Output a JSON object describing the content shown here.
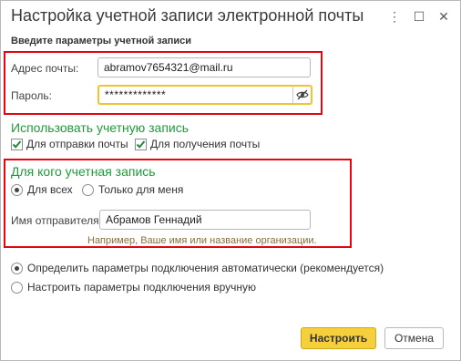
{
  "window": {
    "title": "Настройка учетной записи электронной почты",
    "menu_glyph": "⋮",
    "maximize_glyph": "☐",
    "close_glyph": "✕"
  },
  "subtitle": "Введите параметры учетной записи",
  "account": {
    "email_label": "Адрес почты:",
    "email_value": "abramov7654321@mail.ru",
    "password_label": "Пароль:",
    "password_value": "*************",
    "password_toggle_icon": "eye-slash-icon"
  },
  "usage": {
    "title": "Использовать учетную запись",
    "send_label": "Для отправки почты",
    "send_checked": true,
    "receive_label": "Для получения почты",
    "receive_checked": true
  },
  "audience": {
    "title": "Для кого учетная запись",
    "all_label": "Для всех",
    "all_selected": true,
    "me_label": "Только для меня",
    "me_selected": false,
    "sender_label": "Имя отправителя:",
    "sender_value": "Абрамов Геннадий",
    "sender_hint": "Например, Ваше имя или название организации."
  },
  "connection": {
    "auto_label": "Определить параметры подключения автоматически (рекомендуется)",
    "auto_selected": true,
    "manual_label": "Настроить параметры подключения вручную",
    "manual_selected": false
  },
  "buttons": {
    "configure": "Настроить",
    "cancel": "Отмена"
  },
  "colors": {
    "highlight_border": "#e30613",
    "section_title": "#1f9a3a",
    "primary_button": "#f6d03c",
    "active_field_border": "#f2c32e"
  }
}
